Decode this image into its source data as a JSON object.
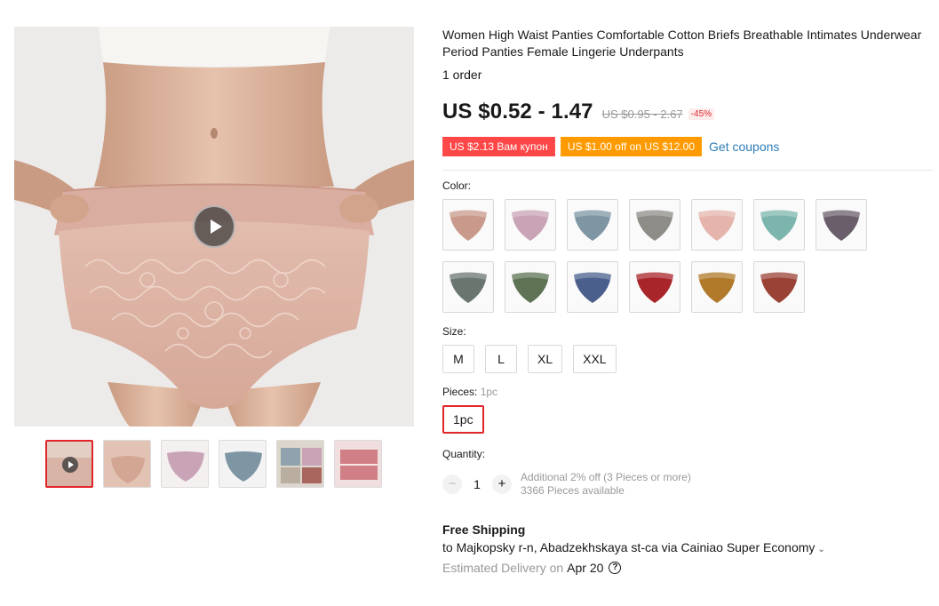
{
  "product": {
    "title": "Women High Waist Panties Comfortable Cotton Briefs Breathable Intimates Underwear Period Panties Female Lingerie Underpants",
    "orders": "1 order",
    "price": "US $0.52 - 1.47",
    "old_price": "US $0.95 - 2.67",
    "discount": "-45%"
  },
  "coupons": {
    "coupon1": "US $2.13 Вам купон",
    "coupon2": "US $1.00 off on US $12.00",
    "get_coupons": "Get coupons"
  },
  "color": {
    "label": "Color:",
    "options": [
      {
        "color": "#c99a8c",
        "name": "swatch-1"
      },
      {
        "color": "#c9a3b6",
        "name": "swatch-2"
      },
      {
        "color": "#7e96a3",
        "name": "swatch-3"
      },
      {
        "color": "#8e8c87",
        "name": "swatch-4"
      },
      {
        "color": "#e5b5ad",
        "name": "swatch-5"
      },
      {
        "color": "#7cb5ad",
        "name": "swatch-6"
      },
      {
        "color": "#6a5e6a",
        "name": "swatch-7"
      },
      {
        "color": "#6b7570",
        "name": "swatch-8"
      },
      {
        "color": "#5d7354",
        "name": "swatch-9"
      },
      {
        "color": "#4a5f8c",
        "name": "swatch-10"
      },
      {
        "color": "#a8252a",
        "name": "swatch-11"
      },
      {
        "color": "#b07a2a",
        "name": "swatch-12"
      },
      {
        "color": "#9a4236",
        "name": "swatch-13"
      }
    ]
  },
  "size": {
    "label": "Size:",
    "options": [
      "M",
      "L",
      "XL",
      "XXL"
    ]
  },
  "pieces": {
    "label": "Pieces:",
    "selected": "1pc",
    "options": [
      "1pc"
    ]
  },
  "quantity": {
    "label": "Quantity:",
    "minus": "−",
    "plus": "+",
    "value": "1",
    "note1": "Additional 2% off (3 Pieces or more)",
    "note2": "3366 Pieces available"
  },
  "shipping": {
    "title": "Free Shipping",
    "to": "to Majkopsky r-n, Abadzekhskaya st-ca via Cainiao Super Economy",
    "chevron": "⌄",
    "estimated": "Estimated Delivery on",
    "date": "Apr 20",
    "help": "?"
  },
  "gallery": {
    "thumbnails": [
      "#d8b4a6",
      "#e2c3b3",
      "#c9a3b6",
      "#7e96a3",
      "#b9aea0",
      "#d17f86"
    ]
  },
  "colors": {
    "accent": "#e0262a",
    "coupon_red": "#ff4747",
    "coupon_orange": "#ff9a00",
    "link": "#2e7db8"
  }
}
